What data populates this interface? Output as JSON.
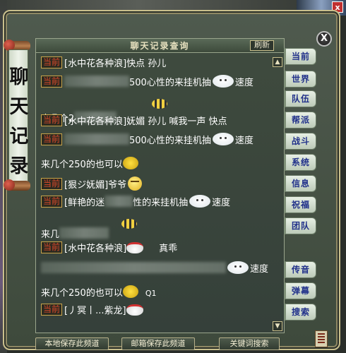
{
  "window": {
    "scroll_title": "聊天记录",
    "panel_title": "聊天记录查询",
    "refresh_label": "刷新",
    "close_label": "X"
  },
  "chat_lines": [
    {
      "tag": "当前",
      "text": "[水中花各种浪]快点 孙儿"
    },
    {
      "tag": "当前",
      "text": "500心性的来挂机抽",
      "suffix": "速度"
    },
    {
      "text": "来几个2"
    },
    {
      "tag": "当前",
      "text": "[水中花各种浪]妩媚 孙儿  喊我一声  快点"
    },
    {
      "tag": "当前",
      "text": "500心性的来挂机抽",
      "suffix": "速度"
    },
    {
      "text": "来几个250的也可以"
    },
    {
      "tag": "当前",
      "text": "[狠ジ妩媚]爷爷"
    },
    {
      "tag": "当前",
      "text": "[鲜艳的迷",
      "mid": "性的来挂机抽",
      "suffix": "速度"
    },
    {
      "text": "来几"
    },
    {
      "tag": "当前",
      "text": "[水中花各种浪]",
      "after": "真乖"
    },
    {
      "suffix": "速度"
    },
    {
      "text": "来几个250的也可以",
      "after": "Q1"
    },
    {
      "tag": "当前",
      "text": "[丿冥丨...紫龙]"
    }
  ],
  "tabs": [
    "当前",
    "世界",
    "队伍",
    "帮派",
    "战斗",
    "系统",
    "信息",
    "祝福",
    "团队",
    "传音",
    "弹幕",
    "搜索"
  ],
  "bottom_buttons": {
    "local_save": "本地保存此频道",
    "mail_save": "邮箱保存此频道",
    "keyword_search": "关键词搜索"
  },
  "icons": {
    "scroll_up": "triangle-up-icon",
    "scroll_down": "triangle-down-icon",
    "close": "close-icon"
  }
}
